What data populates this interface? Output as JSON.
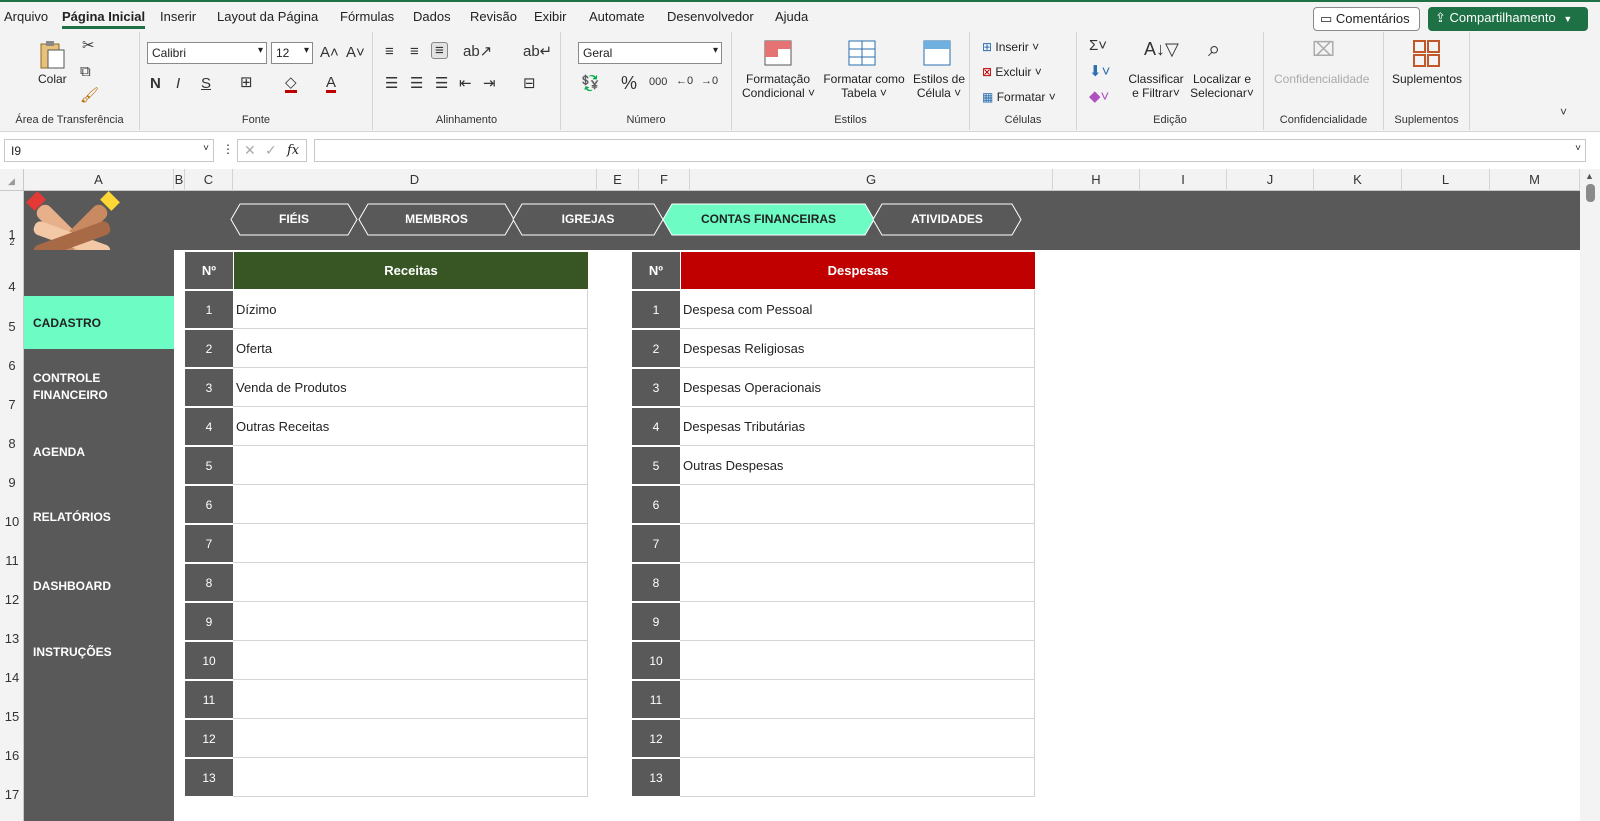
{
  "menu": {
    "items": [
      "Arquivo",
      "Página Inicial",
      "Inserir",
      "Layout da Página",
      "Fórmulas",
      "Dados",
      "Revisão",
      "Exibir",
      "Automate",
      "Desenvolvedor",
      "Ajuda"
    ],
    "comments": "Comentários",
    "share": "Compartilhamento"
  },
  "ribbon": {
    "clipboard": {
      "paste": "Colar",
      "label": "Área de Transferência"
    },
    "font": {
      "name": "Calibri",
      "size": "12",
      "label": "Fonte"
    },
    "alignment": {
      "label": "Alinhamento"
    },
    "number": {
      "format": "Geral",
      "label": "Número"
    },
    "styles": {
      "conditional": [
        "Formatação",
        "Condicional"
      ],
      "table": [
        "Formatar como",
        "Tabela"
      ],
      "cell": [
        "Estilos de",
        "Célula"
      ],
      "label": "Estilos"
    },
    "cells": {
      "insert": "Inserir",
      "delete": "Excluir",
      "format": "Formatar",
      "label": "Células"
    },
    "editing": {
      "sort": [
        "Classificar",
        "e Filtrar"
      ],
      "find": [
        "Localizar e",
        "Selecionar"
      ],
      "label": "Edição"
    },
    "sensitivity": {
      "name": "Confidencialidade",
      "label": "Confidencialidade"
    },
    "addins": {
      "name": "Suplementos",
      "label": "Suplementos"
    }
  },
  "formula_bar": {
    "cell_ref": "I9",
    "fx": "fx",
    "content": ""
  },
  "columns": [
    "A",
    "B",
    "C",
    "D",
    "E",
    "F",
    "G",
    "H",
    "I",
    "J",
    "K",
    "L",
    "M"
  ],
  "rows": [
    "1",
    "2",
    "4",
    "5",
    "6",
    "7",
    "8",
    "9",
    "10",
    "11",
    "12",
    "13",
    "14",
    "15",
    "16",
    "17"
  ],
  "tabs": [
    {
      "label": "FIÉIS",
      "active": false
    },
    {
      "label": "MEMBROS",
      "active": false
    },
    {
      "label": "IGREJAS",
      "active": false
    },
    {
      "label": "CONTAS FINANCEIRAS",
      "active": true
    },
    {
      "label": "ATIVIDADES",
      "active": false
    }
  ],
  "sidebar": [
    {
      "label": "CADASTRO",
      "active": true
    },
    {
      "label": "CONTROLE FINANCEIRO",
      "active": false
    },
    {
      "label": "AGENDA",
      "active": false
    },
    {
      "label": "RELATÓRIOS",
      "active": false
    },
    {
      "label": "DASHBOARD",
      "active": false
    },
    {
      "label": "INSTRUÇÕES",
      "active": false
    }
  ],
  "receitas": {
    "num_header": "Nº",
    "title": "Receitas",
    "color": "#375623",
    "rows": [
      {
        "n": "1",
        "text": "Dízimo"
      },
      {
        "n": "2",
        "text": "Oferta"
      },
      {
        "n": "3",
        "text": "Venda de Produtos"
      },
      {
        "n": "4",
        "text": "Outras Receitas"
      },
      {
        "n": "5",
        "text": ""
      },
      {
        "n": "6",
        "text": ""
      },
      {
        "n": "7",
        "text": ""
      },
      {
        "n": "8",
        "text": ""
      },
      {
        "n": "9",
        "text": ""
      },
      {
        "n": "10",
        "text": ""
      },
      {
        "n": "11",
        "text": ""
      },
      {
        "n": "12",
        "text": ""
      },
      {
        "n": "13",
        "text": ""
      }
    ]
  },
  "despesas": {
    "num_header": "Nº",
    "title": "Despesas",
    "color": "#c00000",
    "rows": [
      {
        "n": "1",
        "text": "Despesa com Pessoal"
      },
      {
        "n": "2",
        "text": "Despesas Religiosas"
      },
      {
        "n": "3",
        "text": "Despesas Operacionais"
      },
      {
        "n": "4",
        "text": "Despesas Tributárias"
      },
      {
        "n": "5",
        "text": "Outras Despesas"
      },
      {
        "n": "6",
        "text": ""
      },
      {
        "n": "7",
        "text": ""
      },
      {
        "n": "8",
        "text": ""
      },
      {
        "n": "9",
        "text": ""
      },
      {
        "n": "10",
        "text": ""
      },
      {
        "n": "11",
        "text": ""
      },
      {
        "n": "12",
        "text": ""
      },
      {
        "n": "13",
        "text": ""
      }
    ]
  },
  "colors": {
    "accent": "#1e7145",
    "active_teal": "#6cfcc4",
    "dark_band": "#595959"
  }
}
